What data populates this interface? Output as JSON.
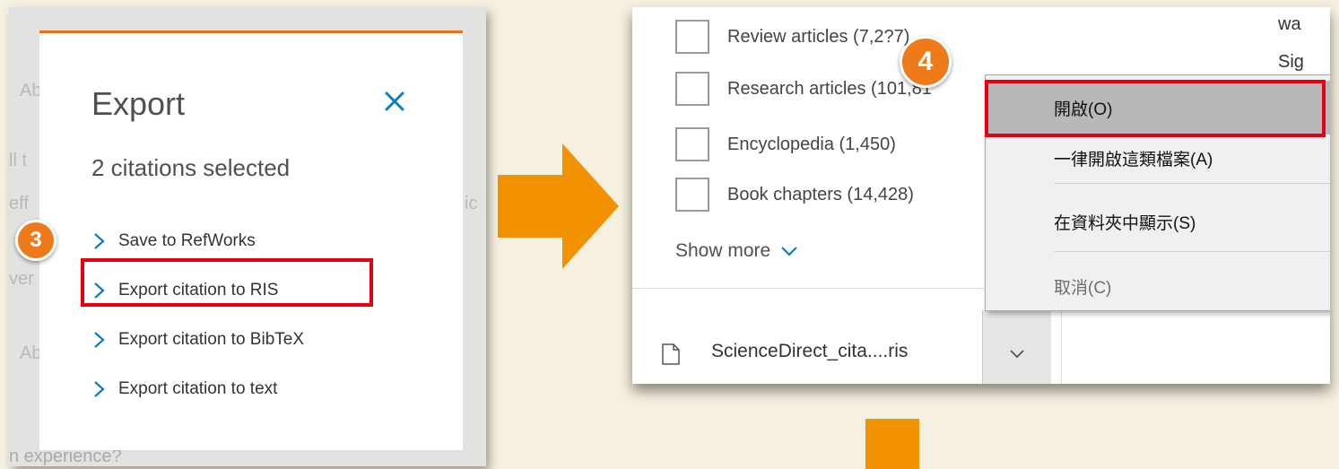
{
  "export_dialog": {
    "title": "Export",
    "selected": "2 citations selected",
    "options": [
      "Save to RefWorks",
      "Export citation to RIS",
      "Export citation to BibTeX",
      "Export citation to text"
    ]
  },
  "background": {
    "ab1": "Ab",
    "ll": "ll t",
    "eff": "eff",
    "ic": "ic",
    "ver": "ver",
    "ab2": "Ab",
    "experience": "n experience?"
  },
  "steps": {
    "left": "3",
    "right": "4"
  },
  "filters": {
    "items": [
      "Review articles (7,2?7)",
      "Research articles (101,81",
      "Encyclopedia (1,450)",
      "Book chapters (14,428)"
    ],
    "show_more": "Show more"
  },
  "right_side": {
    "wa": "wa",
    "sig": "Sig"
  },
  "download": {
    "filename": "ScienceDirect_cita....ris"
  },
  "context_menu": {
    "items": [
      "開啟(O)",
      "一律開啟這類檔案(A)",
      "在資料夾中顯示(S)",
      "取消(C)"
    ]
  },
  "colors": {
    "accent": "#f39200",
    "highlight": "#e60012",
    "link": "#0c7dbb"
  }
}
